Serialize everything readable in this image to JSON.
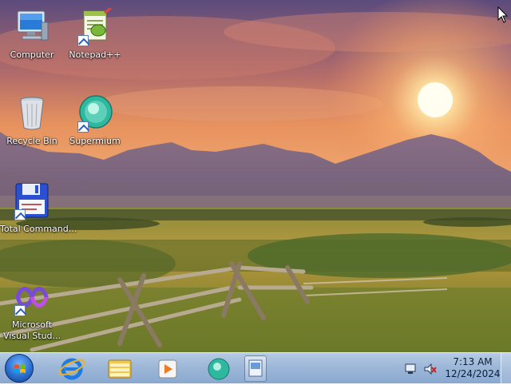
{
  "desktop": {
    "icons": [
      {
        "label": "Computer",
        "icon": "computer-icon"
      },
      {
        "label": "Notepad++",
        "icon": "notepad-plus-plus-icon"
      },
      {
        "label": "Recycle Bin",
        "icon": "recycle-bin-icon"
      },
      {
        "label": "Supermium",
        "icon": "supermium-icon"
      },
      {
        "label": "Total Command...",
        "icon": "total-commander-icon"
      },
      {
        "label": "Microsoft Visual Stud...",
        "icon": "visual-studio-icon"
      }
    ]
  },
  "taskbar": {
    "pinned": [
      {
        "icon": "internet-explorer-icon"
      },
      {
        "icon": "file-explorer-icon"
      },
      {
        "icon": "media-player-icon"
      },
      {
        "icon": "supermium-icon"
      },
      {
        "icon": "notepad-plus-plus-icon"
      }
    ],
    "tray": {
      "icons": [
        "action-center-icon",
        "volume-muted-icon"
      ],
      "time": "7:13 AM",
      "date": "12/24/2024"
    }
  },
  "colors": {
    "taskbar": "#9db7d8",
    "sky_top": "#5a4a7a",
    "sun": "#fff4c8",
    "grass": "#6d7a2a"
  }
}
